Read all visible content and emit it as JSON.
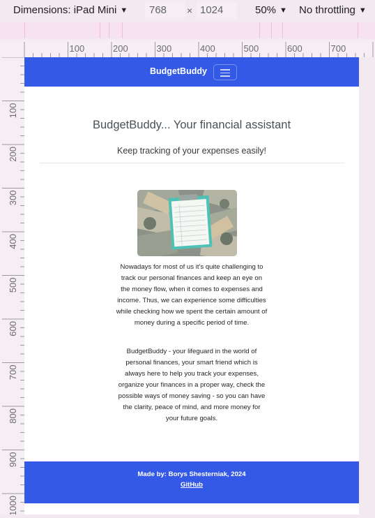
{
  "devtools": {
    "dimensions_label": "Dimensions: iPad Mini",
    "width": "768",
    "times": "×",
    "height": "1024",
    "zoom": "50%",
    "throttling": "No throttling",
    "caret": "▼"
  },
  "ruler": {
    "top_labels": [
      "100",
      "200",
      "300",
      "400",
      "500",
      "600",
      "700"
    ],
    "left_labels": [
      "100",
      "200",
      "300",
      "400",
      "500",
      "600",
      "700",
      "800",
      "900",
      "1000"
    ]
  },
  "navbar": {
    "brand": "BudgetBuddy"
  },
  "hero": {
    "title": "BudgetBuddy... Your financial assistant",
    "subtitle": "Keep tracking of your expenses easily!"
  },
  "content": {
    "paragraph1": "Nowadays for most of us it's quite challenging to track our personal finances and keep an eye on the money flow, when it comes to expenses and income. Thus, we can experience some difficulties while checking how we spent the certain amount of money during a specific period of time.",
    "paragraph2": "BudgetBuddy - your lifeguard in the world of personal finances, your smart friend which is always here to help you track your expenses, organize your finances in a proper way, check the possible ways of money saving - so you can have the clarity, peace of mind, and more money for your future goals."
  },
  "footer": {
    "made_by": "Made by: Borys Shesterniak, 2024",
    "github": "GitHub"
  },
  "colors": {
    "primary": "#3459e6",
    "devtools_bg": "#f3e9f1"
  }
}
